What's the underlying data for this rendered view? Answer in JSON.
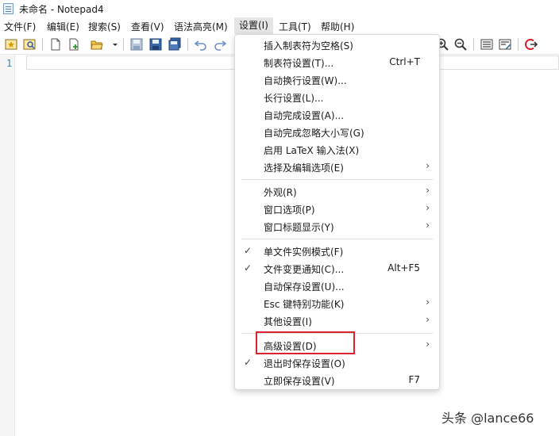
{
  "window": {
    "title": "未命名 - Notepad4"
  },
  "menubar": {
    "items": [
      {
        "label": "文件(F)"
      },
      {
        "label": "编辑(E)"
      },
      {
        "label": "搜索(S)"
      },
      {
        "label": "查看(V)"
      },
      {
        "label": "语法高亮(M)"
      },
      {
        "label": "设置(I)"
      },
      {
        "label": "工具(T)"
      },
      {
        "label": "帮助(H)"
      }
    ]
  },
  "editor": {
    "line_number": "1"
  },
  "settings_menu": {
    "items": [
      {
        "label": "插入制表符为空格(S)",
        "shortcut": ""
      },
      {
        "label": "制表符设置(T)...",
        "shortcut": "Ctrl+T"
      },
      {
        "label": "自动换行设置(W)...",
        "shortcut": ""
      },
      {
        "label": "长行设置(L)...",
        "shortcut": ""
      },
      {
        "label": "自动完成设置(A)...",
        "shortcut": ""
      },
      {
        "label": "自动完成忽略大小写(G)",
        "shortcut": ""
      },
      {
        "label": "启用 LaTeX 输入法(X)",
        "shortcut": ""
      },
      {
        "label": "选择及编辑选项(E)",
        "shortcut": ""
      },
      {
        "label": "外观(R)",
        "shortcut": ""
      },
      {
        "label": "窗口选项(P)",
        "shortcut": ""
      },
      {
        "label": "窗口标题显示(Y)",
        "shortcut": ""
      },
      {
        "label": "单文件实例模式(F)",
        "shortcut": ""
      },
      {
        "label": "文件变更通知(C)...",
        "shortcut": "Alt+F5"
      },
      {
        "label": "自动保存设置(U)...",
        "shortcut": ""
      },
      {
        "label": "Esc 键特别功能(K)",
        "shortcut": ""
      },
      {
        "label": "其他设置(I)",
        "shortcut": ""
      },
      {
        "label": "高级设置(D)",
        "shortcut": ""
      },
      {
        "label": "退出时保存设置(O)",
        "shortcut": ""
      },
      {
        "label": "立即保存设置(V)",
        "shortcut": "F7"
      }
    ]
  },
  "watermark": "头条 @lance66",
  "colors": {
    "highlight": "#d9232e",
    "line_number": "#2b91af"
  }
}
